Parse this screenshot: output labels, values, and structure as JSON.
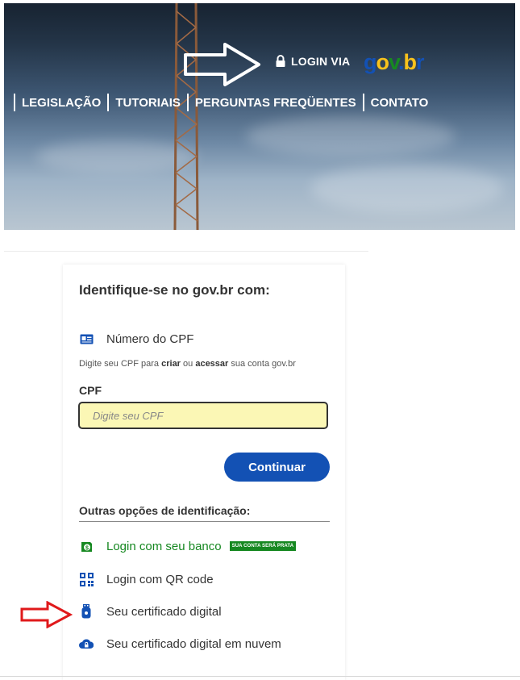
{
  "header": {
    "login_via": "LOGIN VIA",
    "logo": {
      "g": "g",
      "o": "o",
      "v": "v",
      "dot": ".",
      "b": "b",
      "r": "r"
    },
    "nav": [
      "LEGISLAÇÃO",
      "TUTORIAIS",
      "PERGUNTAS FREQÜENTES",
      "CONTATO"
    ]
  },
  "card": {
    "title": "Identifique-se no gov.br com:",
    "cpf_option": "Número do CPF",
    "hint": {
      "p1": "Digite seu CPF para ",
      "criar": "criar",
      "p2": " ou ",
      "acessar": "acessar",
      "p3": " sua conta gov.br"
    },
    "cpf_label": "CPF",
    "cpf_placeholder": "Digite seu CPF",
    "continue_label": "Continuar",
    "other_options_title": "Outras opções de identificação:",
    "options": [
      {
        "label": "Login com seu banco",
        "badge": "SUA CONTA SERÁ PRATA"
      },
      {
        "label": "Login com QR code"
      },
      {
        "label": "Seu certificado digital"
      },
      {
        "label": "Seu certificado digital em nuvem"
      }
    ]
  },
  "colors": {
    "primary": "#1351b4",
    "green": "#168821",
    "input_bg": "#fbf7b5",
    "annotation_red": "#e0191b"
  }
}
